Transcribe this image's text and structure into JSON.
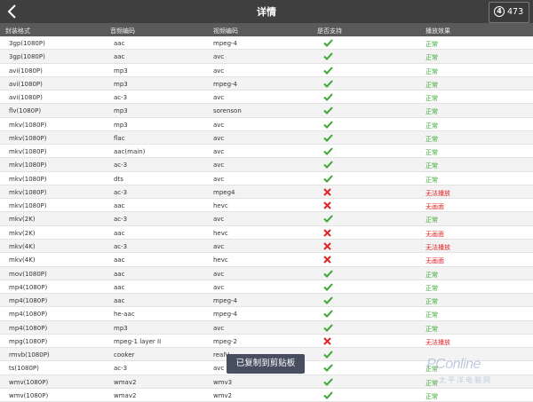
{
  "header": {
    "title": "详情",
    "badge_icon_text": "4",
    "badge_count": "473"
  },
  "columns": [
    "封装格式",
    "音频编码",
    "视频编码",
    "是否支持",
    "播放效果"
  ],
  "rows": [
    {
      "container": "3gp(1080P)",
      "audio": "aac",
      "video": "mpeg-4",
      "supported": true,
      "effect": "正常"
    },
    {
      "container": "3gp(1080P)",
      "audio": "aac",
      "video": "avc",
      "supported": true,
      "effect": "正常"
    },
    {
      "container": "avi(1080P)",
      "audio": "mp3",
      "video": "avc",
      "supported": true,
      "effect": "正常"
    },
    {
      "container": "avi(1080P)",
      "audio": "mp3",
      "video": "mpeg-4",
      "supported": true,
      "effect": "正常"
    },
    {
      "container": "avi(1080P)",
      "audio": "ac-3",
      "video": "avc",
      "supported": true,
      "effect": "正常"
    },
    {
      "container": "flv(1080P)",
      "audio": "mp3",
      "video": "sorenson",
      "supported": true,
      "effect": "正常"
    },
    {
      "container": "mkv(1080P)",
      "audio": "mp3",
      "video": "avc",
      "supported": true,
      "effect": "正常"
    },
    {
      "container": "mkv(1080P)",
      "audio": "flac",
      "video": "avc",
      "supported": true,
      "effect": "正常"
    },
    {
      "container": "mkv(1080P)",
      "audio": "aac(main)",
      "video": "avc",
      "supported": true,
      "effect": "正常"
    },
    {
      "container": "mkv(1080P)",
      "audio": "ac-3",
      "video": "avc",
      "supported": true,
      "effect": "正常"
    },
    {
      "container": "mkv(1080P)",
      "audio": "dts",
      "video": "avc",
      "supported": true,
      "effect": "正常"
    },
    {
      "container": "mkv(1080P)",
      "audio": "ac-3",
      "video": "mpeg4",
      "supported": false,
      "effect": "无法播放"
    },
    {
      "container": "mkv(1080P)",
      "audio": "aac",
      "video": "hevc",
      "supported": false,
      "effect": "无画面"
    },
    {
      "container": "mkv(2K)",
      "audio": "ac-3",
      "video": "avc",
      "supported": true,
      "effect": "正常"
    },
    {
      "container": "mkv(2K)",
      "audio": "aac",
      "video": "hevc",
      "supported": false,
      "effect": "无画面"
    },
    {
      "container": "mkv(4K)",
      "audio": "ac-3",
      "video": "avc",
      "supported": false,
      "effect": "无法播放"
    },
    {
      "container": "mkv(4K)",
      "audio": "aac",
      "video": "hevc",
      "supported": false,
      "effect": "无画面"
    },
    {
      "container": "mov(1080P)",
      "audio": "aac",
      "video": "avc",
      "supported": true,
      "effect": "正常"
    },
    {
      "container": "mp4(1080P)",
      "audio": "aac",
      "video": "avc",
      "supported": true,
      "effect": "正常"
    },
    {
      "container": "mp4(1080P)",
      "audio": "aac",
      "video": "mpeg-4",
      "supported": true,
      "effect": "正常"
    },
    {
      "container": "mp4(1080P)",
      "audio": "he-aac",
      "video": "mpeg-4",
      "supported": true,
      "effect": "正常"
    },
    {
      "container": "mp4(1080P)",
      "audio": "mp3",
      "video": "avc",
      "supported": true,
      "effect": "正常"
    },
    {
      "container": "mpg(1080P)",
      "audio": "mpeg-1 layer II",
      "video": "mpeg-2",
      "supported": false,
      "effect": "无法播放"
    },
    {
      "container": "rmvb(1080P)",
      "audio": "cooker",
      "video": "realV",
      "supported": true,
      "effect": ""
    },
    {
      "container": "ts(1080P)",
      "audio": "ac-3",
      "video": "avc",
      "supported": true,
      "effect": "正常"
    },
    {
      "container": "wmv(1080P)",
      "audio": "wmav2",
      "video": "wmv3",
      "supported": true,
      "effect": "正常"
    },
    {
      "container": "wmv(1080P)",
      "audio": "wmav2",
      "video": "wmv2",
      "supported": true,
      "effect": "正常"
    }
  ],
  "toast": "已复制到剪贴板",
  "watermark": {
    "line1": "PConline",
    "line2": "太平洋电脑网"
  },
  "colors": {
    "header_bg": "#3f3f3f",
    "table_header_bg": "#5a5a5a",
    "ok": "#3aa832",
    "bad": "#e02525"
  }
}
